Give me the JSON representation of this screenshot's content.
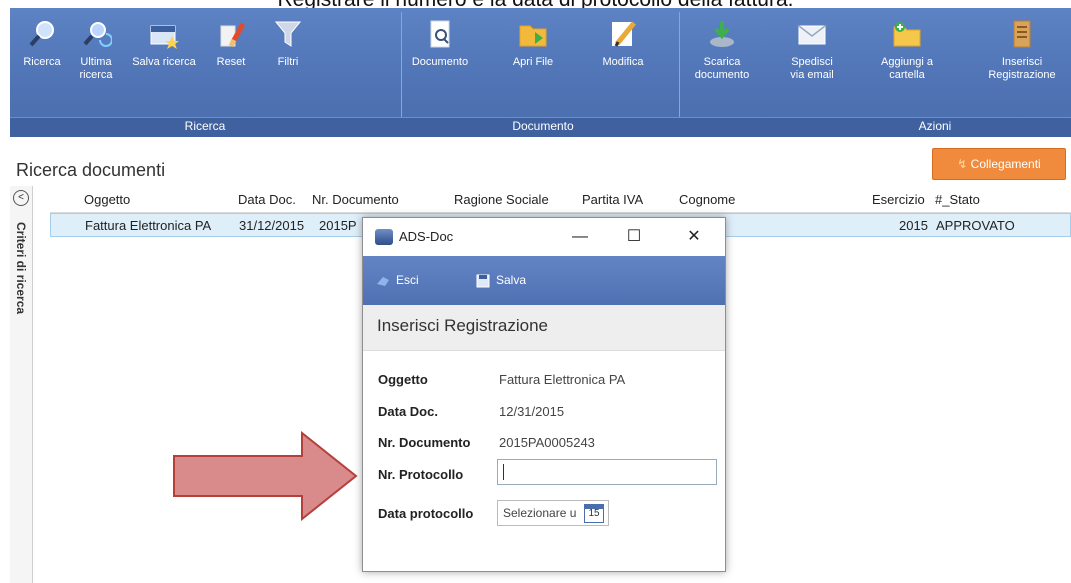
{
  "caption": "Registrare il numero e la data di protocollo della fattura.",
  "ribbon": {
    "buttons": [
      {
        "label": "Ricerca",
        "icon": "search-icon"
      },
      {
        "label": "Ultima ricerca",
        "icon": "last-search-icon"
      },
      {
        "label": "Salva ricerca",
        "icon": "save-search-icon"
      },
      {
        "label": "Reset",
        "icon": "eraser-icon"
      },
      {
        "label": "Filtri",
        "icon": "filter-icon"
      },
      {
        "label": "Documento",
        "icon": "document-icon"
      },
      {
        "label": "Apri File",
        "icon": "folder-icon"
      },
      {
        "label": "Modifica",
        "icon": "pencil-icon"
      },
      {
        "label": "Scarica documento",
        "icon": "download-icon"
      },
      {
        "label": "Spedisci via email",
        "icon": "email-icon"
      },
      {
        "label": "Aggiungi a cartella",
        "icon": "add-folder-icon"
      },
      {
        "label": "Inserisci Registrazione",
        "icon": "register-icon"
      }
    ],
    "groups": [
      "Ricerca",
      "Documento",
      "Azioni"
    ]
  },
  "panel": {
    "title": "Ricerca documenti",
    "collegamenti": "Collegamenti",
    "side_label": "Criteri di ricerca",
    "collapse_glyph": "<"
  },
  "grid": {
    "columns": [
      "Oggetto",
      "Data Doc.",
      "Nr. Documento",
      "Ragione Sociale",
      "Partita IVA",
      "Cognome",
      "Esercizio",
      "#_Stato"
    ],
    "row": {
      "oggetto": "Fattura Elettronica PA",
      "data": "31/12/2015",
      "nr_prefix": "2015P",
      "esercizio": "2015",
      "stato": "APPROVATO"
    }
  },
  "dialog": {
    "title": "ADS-Doc",
    "minimize": "—",
    "maximize": "☐",
    "close": "✕",
    "esci": "Esci",
    "salva": "Salva",
    "subtitle": "Inserisci Registrazione",
    "fields": {
      "oggetto_label": "Oggetto",
      "oggetto_value": "Fattura Elettronica PA",
      "data_label": "Data Doc.",
      "data_value": "12/31/2015",
      "nr_label": "Nr. Documento",
      "nr_value": "2015PA0005243",
      "protocollo_label": "Nr. Protocollo",
      "protocollo_value": "",
      "data_prot_label": "Data protocollo",
      "data_prot_placeholder": "Selezionare u",
      "calendar_day": "15"
    }
  },
  "colors": {
    "ribbon": "#4f73b4",
    "accent": "#f08a3c",
    "arrow": "#d98a8a",
    "arrow_border": "#b5403b",
    "selected_row": "#dfeff9"
  }
}
